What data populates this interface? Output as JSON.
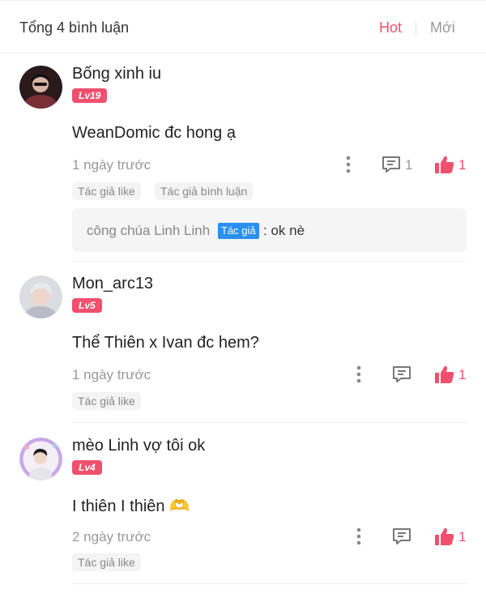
{
  "header": {
    "count_label": "Tổng 4 bình luận",
    "tab_hot": "Hot",
    "tab_new": "Mới"
  },
  "colors": {
    "accent": "#f0506e",
    "author_badge": "#2b8ff0",
    "muted_text": "#999999"
  },
  "comments": [
    {
      "username": "Bống xinh iu",
      "level": "Lv19",
      "content": "WeanDomic đc hong ạ",
      "time": "1 ngày trước",
      "reply_count": "1",
      "like_count": "1",
      "tags": [
        "Tác giả like",
        "Tác giả bình luận"
      ],
      "reply": {
        "name": "công chúa Linh Linh",
        "badge": "Tác giả",
        "text": ": ok nè"
      }
    },
    {
      "username": "Mon_arc13",
      "level": "Lv5",
      "content": "Thể Thiên x Ivan đc hem?",
      "time": "1 ngày trước",
      "like_count": "1",
      "tags": [
        "Tác giả like"
      ]
    },
    {
      "username": "mèo Linh vợ tôi ok",
      "level": "Lv4",
      "content": "I thiên I thiên 🫶",
      "time": "2 ngày trước",
      "like_count": "1",
      "tags": [
        "Tác giả like"
      ]
    }
  ]
}
